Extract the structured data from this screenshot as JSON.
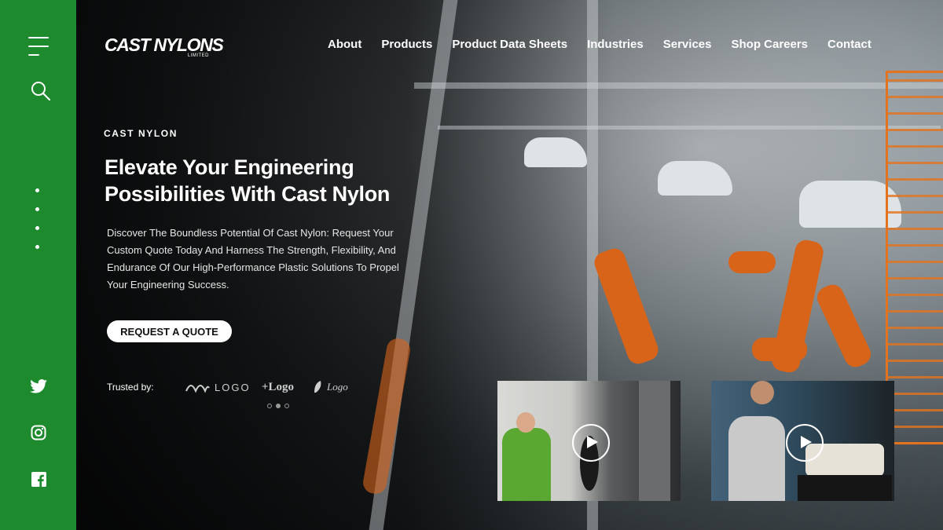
{
  "brand": {
    "name": "CAST NYLONS",
    "suffix": "LIMITED"
  },
  "nav": {
    "items": [
      {
        "label": "About"
      },
      {
        "label": "Products"
      },
      {
        "label": "Product Data Sheets"
      },
      {
        "label": "Industries"
      },
      {
        "label": "Services"
      },
      {
        "label": "Shop Careers"
      },
      {
        "label": "Contact"
      }
    ]
  },
  "sidebar": {
    "menu_icon": "hamburger-icon",
    "search_icon": "search-icon",
    "social": [
      "twitter-icon",
      "instagram-icon",
      "facebook-icon"
    ]
  },
  "hero": {
    "eyebrow": "CAST NYLON",
    "headline_line1": "Elevate Your Engineering",
    "headline_line2": "Possibilities With Cast Nylon",
    "description": "Discover The Boundless Potential Of Cast Nylon: Request Your Custom Quote Today And Harness The Strength, Flexibility, And Endurance Of Our High-Performance Plastic Solutions To Propel Your Engineering Success.",
    "cta_label": "REQUEST A QUOTE"
  },
  "trusted": {
    "label": "Trusted by:",
    "logos": [
      "LOGO",
      "+Logo",
      "Logo"
    ]
  },
  "colors": {
    "sidebar_green": "#1e8a2e",
    "accent_orange": "#d8641a",
    "button_bg": "#ffffff"
  }
}
